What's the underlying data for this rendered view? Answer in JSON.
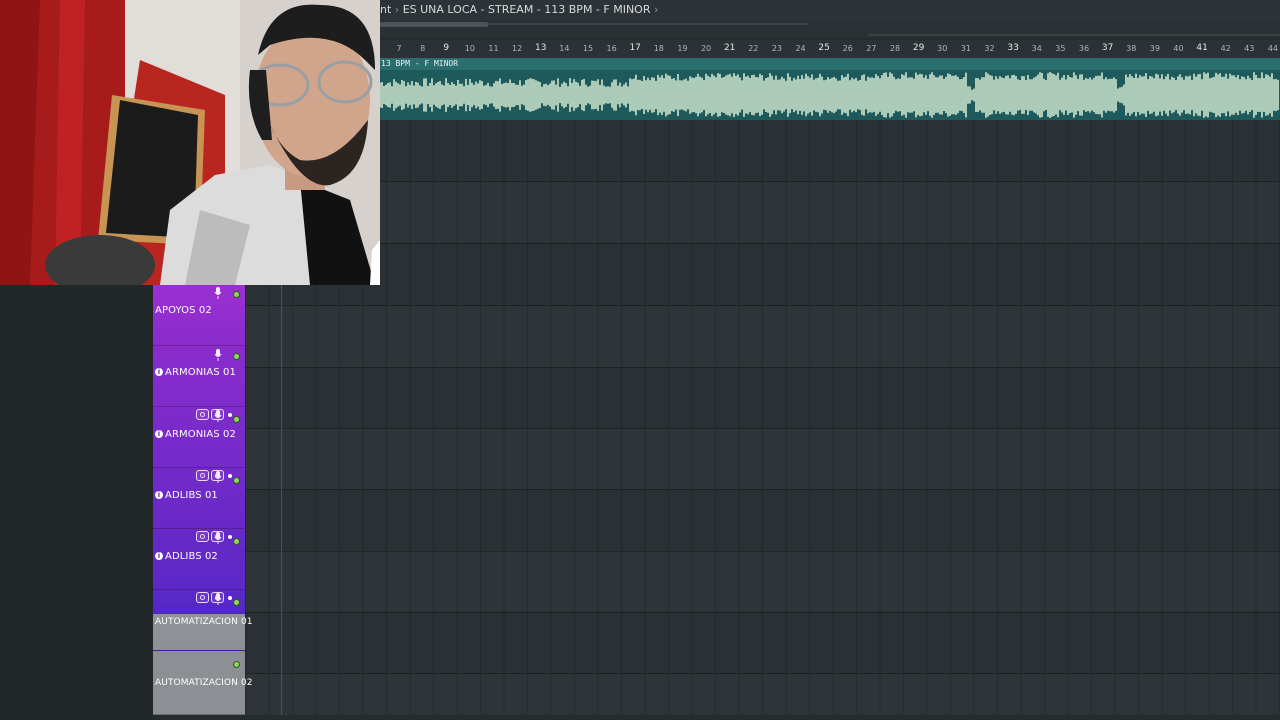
{
  "title_bar": {
    "prefix": "nt",
    "separator": "›",
    "project_name": "ES UNA LOCA - STREAM - 113 BPM - F MINOR",
    "trailing": "›"
  },
  "ruler": {
    "minor": [
      "7",
      "8",
      "10",
      "11",
      "12",
      "14",
      "15",
      "16",
      "18",
      "19",
      "20",
      "22",
      "23",
      "24",
      "26",
      "27",
      "28",
      "30",
      "31",
      "32",
      "34",
      "35",
      "36",
      "38",
      "39",
      "40",
      "42",
      "43",
      "44"
    ],
    "major": [
      "9",
      "13",
      "17",
      "21",
      "25",
      "29",
      "33",
      "37",
      "41"
    ]
  },
  "clip": {
    "label": "13 BPM - F MINOR"
  },
  "tracks": [
    {
      "name": "APOYOS 02",
      "info": false,
      "controls": false
    },
    {
      "name": "ARMONIAS 01",
      "info": true,
      "controls": false
    },
    {
      "name": "ARMONIAS 02",
      "info": true,
      "controls": true
    },
    {
      "name": "ADLIBS 01",
      "info": true,
      "controls": true
    },
    {
      "name": "ADLIBS 02",
      "info": true,
      "controls": true
    },
    {
      "name": "AUTOMATIZACION 01",
      "info": false,
      "controls": true
    },
    {
      "name": "AUTOMATIZACION 02",
      "info": false,
      "controls": false
    }
  ],
  "colors": {
    "track_purple_top": "#9a2fd0",
    "track_purple_bottom": "#5a27c8",
    "automation_gray": "#8a8f93",
    "clip_teal": "#1e5a5c",
    "waveform": "#cfe8d0",
    "background": "#262b2e"
  },
  "icons": [
    "mic-icon",
    "record-dot-icon",
    "info-icon",
    "speaker-icon",
    "monitor-icon"
  ]
}
